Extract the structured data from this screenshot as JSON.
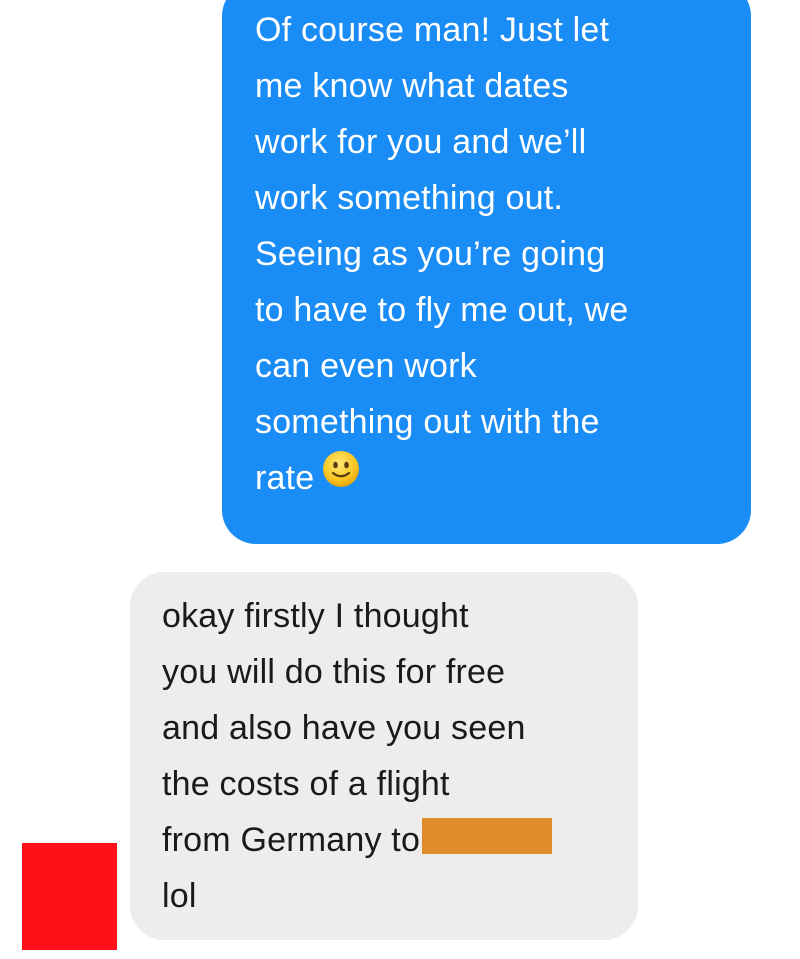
{
  "messages": {
    "sent": {
      "lines": [
        "Of course man! Just let",
        "me know what dates",
        "work for you and we’ll",
        "work something out.",
        "Seeing as you’re going",
        "to have to fly me out, we",
        "can even work",
        "something out with the",
        "rate"
      ],
      "emoji": "slightly-smiling-face"
    },
    "received": {
      "lines": [
        "okay firstly I thought",
        "you will do this for free",
        "and also have you seen",
        "the costs of a flight",
        "from Germany to",
        "lol"
      ]
    }
  },
  "colors": {
    "sent_bubble": "#1a8cf5",
    "received_bubble": "#ededee",
    "redaction_orange": "#e08c2a",
    "redaction_red": "#ff0f17"
  }
}
